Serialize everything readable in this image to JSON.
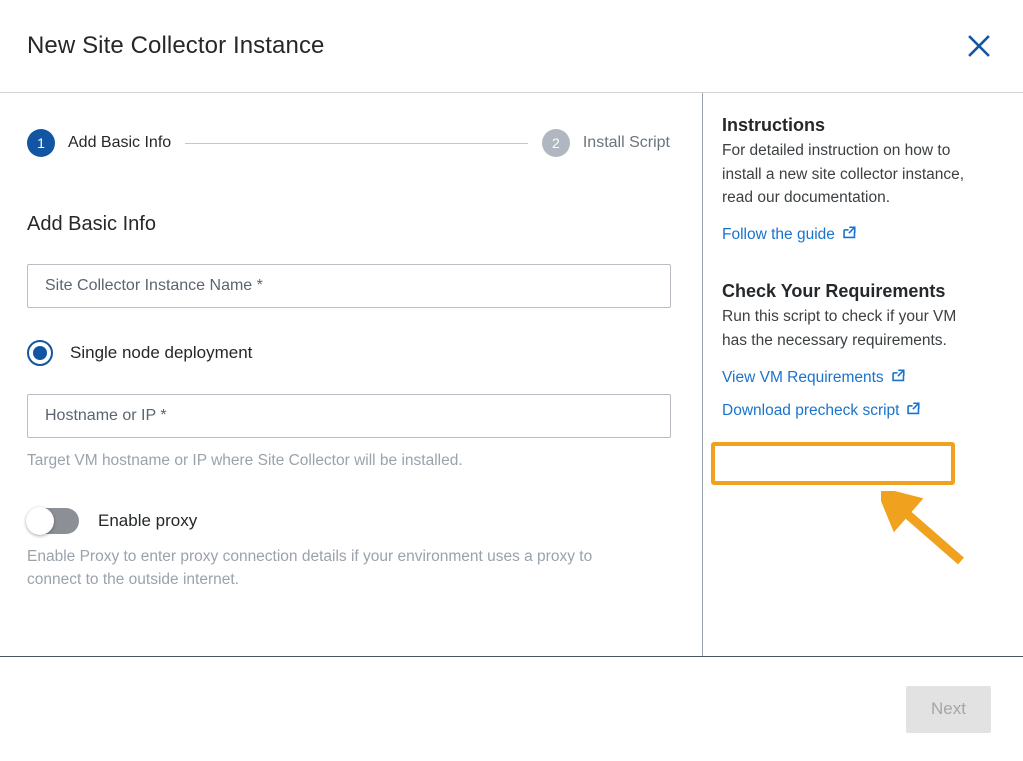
{
  "dialog": {
    "title": "New Site Collector Instance",
    "close_icon": "close-icon"
  },
  "stepper": {
    "steps": [
      {
        "number": "1",
        "label": "Add Basic Info",
        "state": "active"
      },
      {
        "number": "2",
        "label": "Install Script",
        "state": "inactive"
      }
    ]
  },
  "form": {
    "section_heading": "Add Basic Info",
    "instance_name": {
      "placeholder": "Site Collector Instance Name *",
      "value": ""
    },
    "deployment_radio": {
      "label": "Single node deployment",
      "selected": true
    },
    "hostname": {
      "placeholder": "Hostname or IP *",
      "value": "",
      "helper": "Target VM hostname or IP where Site Collector will be installed."
    },
    "proxy_toggle": {
      "label": "Enable proxy",
      "enabled": false,
      "helper": "Enable Proxy to enter proxy connection details if your environment uses a proxy to connect to the outside internet."
    }
  },
  "info": {
    "instructions": {
      "heading": "Instructions",
      "text": "For detailed instruction on how to install a new site collector instance, read our documentation.",
      "link": "Follow the guide"
    },
    "requirements": {
      "heading": "Check Your Requirements",
      "text": "Run this script to check if your VM has the necessary requirements.",
      "link_view": "View VM Requirements",
      "link_download": "Download precheck script"
    }
  },
  "footer": {
    "next_label": "Next",
    "next_disabled": true
  },
  "annotation": {
    "highlight_color": "#f0a11e",
    "arrow_color": "#f0a11e",
    "target": "Download precheck script"
  },
  "colors": {
    "accent_blue": "#1256a3",
    "link_blue": "#1a73cc",
    "step_inactive": "#b0b7c0",
    "helper_gray": "#9aa2ab"
  }
}
